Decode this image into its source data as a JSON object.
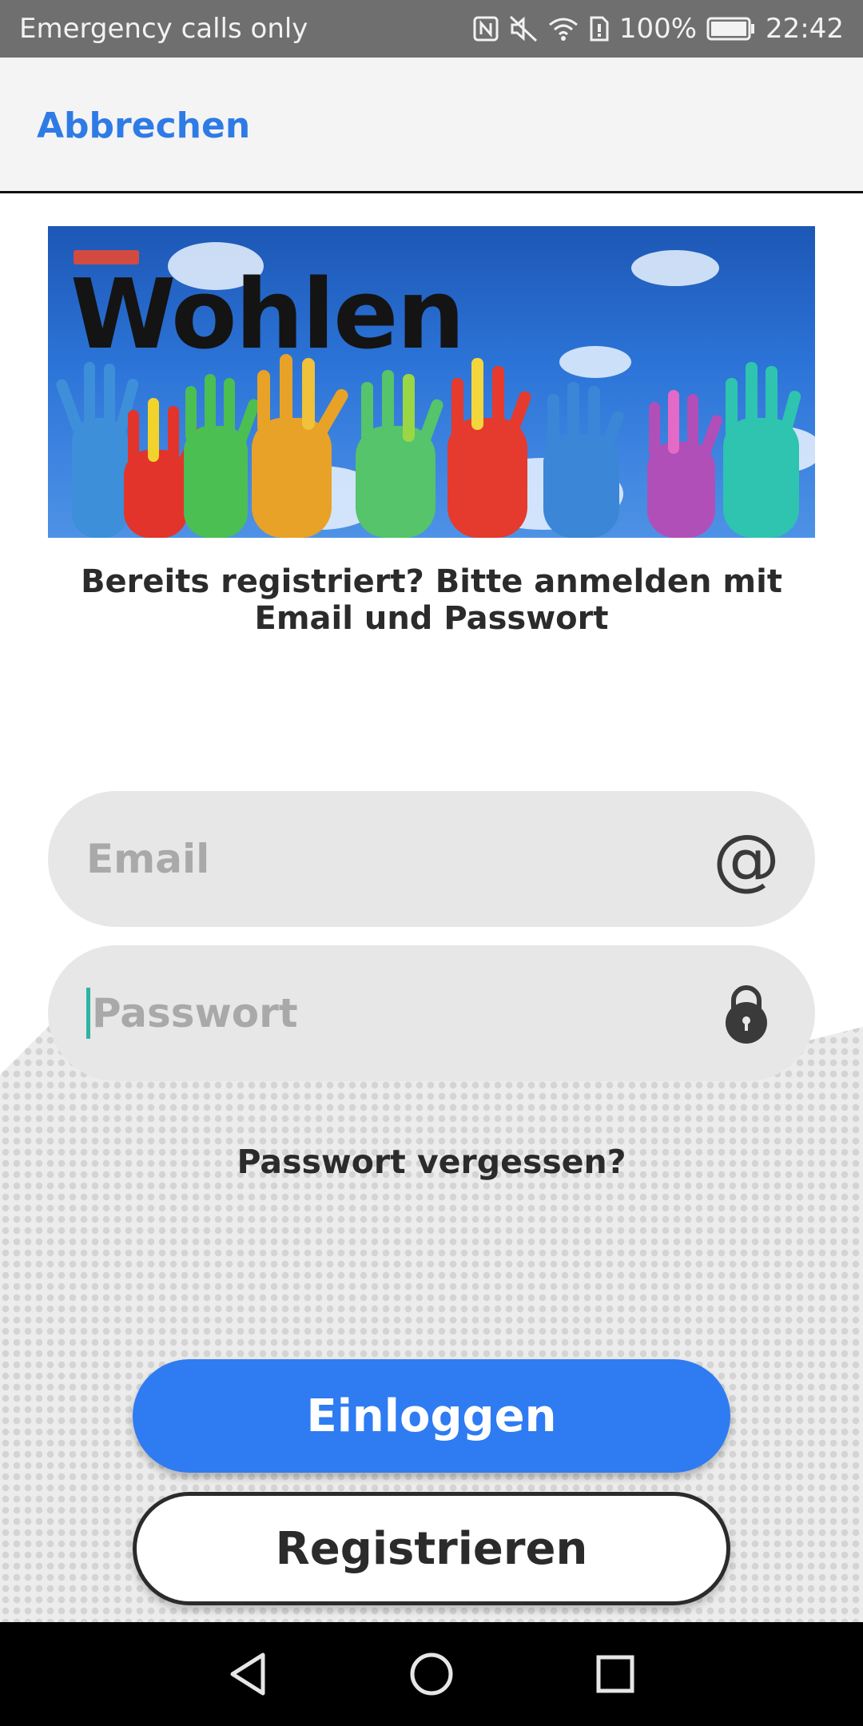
{
  "status_bar": {
    "carrier_text": "Emergency calls only",
    "battery_percent": "100%",
    "time": "22:42",
    "icons": [
      "nfc-icon",
      "mute-icon",
      "wifi-icon",
      "sim-icon",
      "battery-icon"
    ]
  },
  "header": {
    "cancel_label": "Abbrechen"
  },
  "banner": {
    "logo_text": "Wohlen"
  },
  "login": {
    "intro": "Bereits registriert? Bitte anmelden mit Email und Passwort",
    "email_placeholder": "Email",
    "email_icon_glyph": "@",
    "password_placeholder": "Passwort",
    "forgot_label": "Passwort vergessen?",
    "login_label": "Einloggen",
    "register_label": "Registrieren"
  },
  "colors": {
    "accent": "#2f7bf2",
    "link": "#2f7be6",
    "status_bar": "#6f6f6f",
    "logo_red": "#d34a41"
  },
  "navigation": {
    "buttons": [
      "back-icon",
      "home-icon",
      "recents-icon"
    ]
  }
}
